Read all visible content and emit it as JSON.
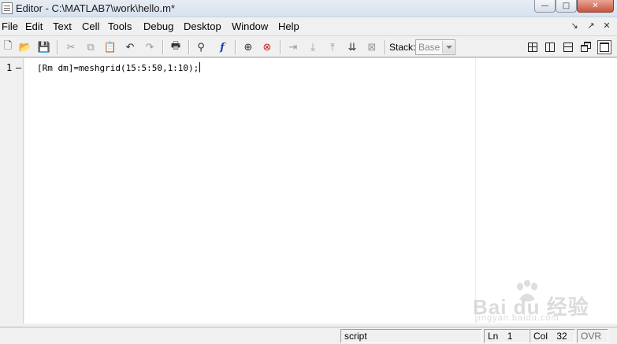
{
  "window": {
    "title": "Editor - C:\\MATLAB7\\work\\hello.m*"
  },
  "menu": {
    "items": [
      "File",
      "Edit",
      "Text",
      "Cell",
      "Tools",
      "Debug",
      "Desktop",
      "Window",
      "Help"
    ]
  },
  "toolbar": {
    "stack_label": "Stack:",
    "stack_value": "Base"
  },
  "editor": {
    "line_number": "1",
    "line_marker": "–",
    "code_line": "[Rm dm]=meshgrid(15:5:50,1:10);"
  },
  "status": {
    "mode": "script",
    "ln_label": "Ln",
    "ln_value": "1",
    "col_label": "Col",
    "col_value": "32",
    "ovr": "OVR"
  },
  "watermark": {
    "text": "Bai du 经验",
    "sub": "jingyan.baidu.com"
  }
}
